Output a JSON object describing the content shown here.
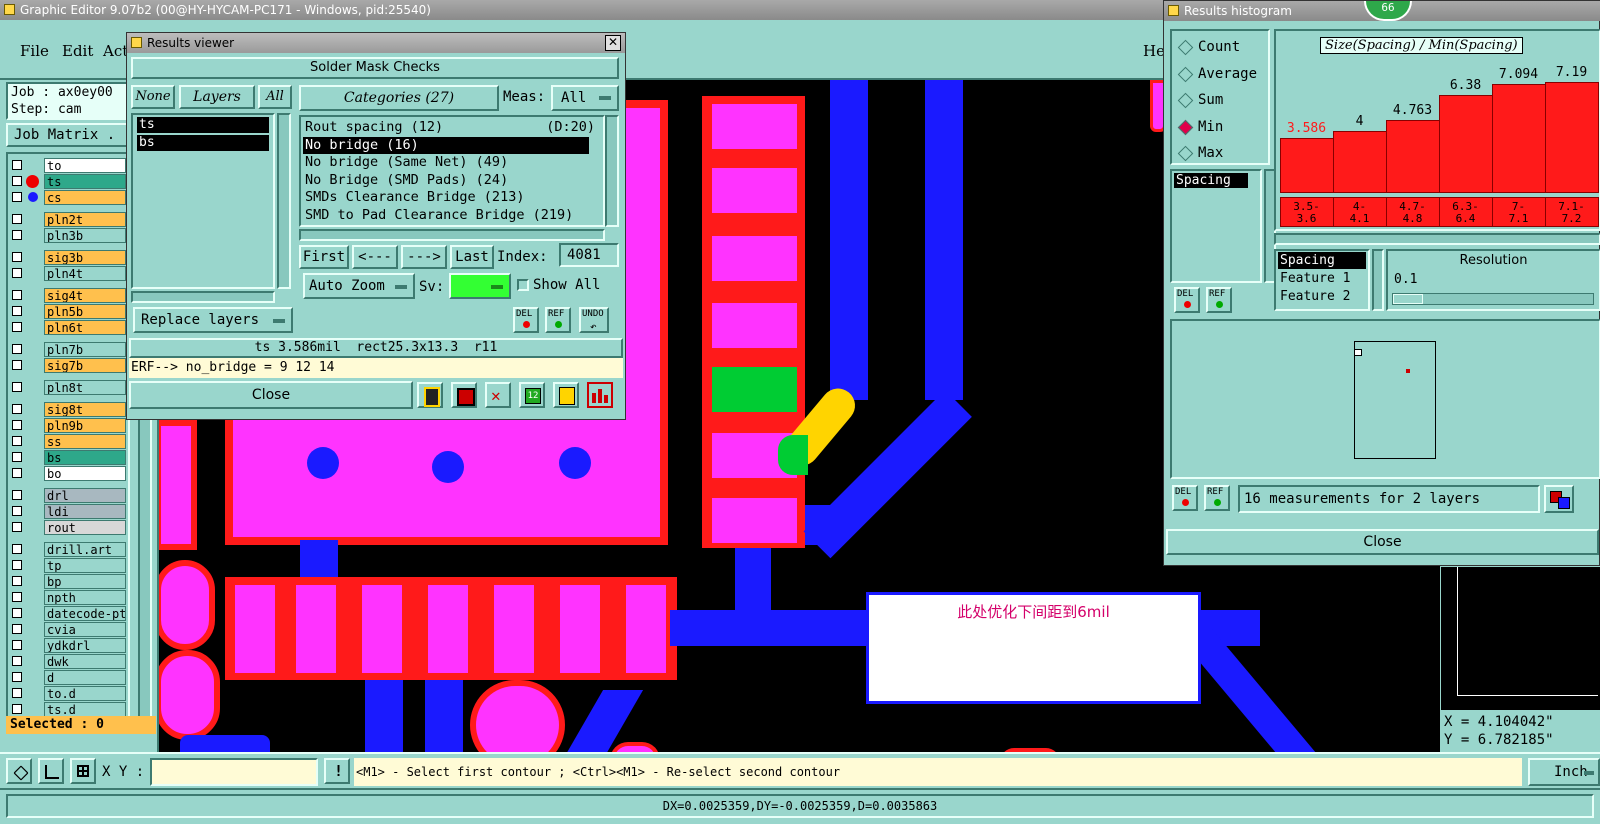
{
  "main_window": {
    "title": "Graphic Editor 9.07b2 (00@HY-HYCAM-PC171 - Windows, pid:25540)"
  },
  "menu": {
    "file": "File",
    "edit": "Edit",
    "actions": "Act",
    "help": "He"
  },
  "job": {
    "job_label": "Job : ax0ey00",
    "step_label": "Step: cam",
    "matrix_button": "Job Matrix ."
  },
  "layers": [
    {
      "name": "to",
      "color": "#ffffff"
    },
    {
      "name": "ts",
      "color": "#2ea88a"
    },
    {
      "name": "cs",
      "color": "#ffc04d"
    },
    {
      "name": "pln2t",
      "color": "#ffc04d"
    },
    {
      "name": "pln3b",
      "color": "#99d6cc"
    },
    {
      "name": "sig3b",
      "color": "#ffc04d"
    },
    {
      "name": "pln4t",
      "color": "#99d6cc"
    },
    {
      "name": "sig4t",
      "color": "#ffc04d"
    },
    {
      "name": "pln5b",
      "color": "#ffc04d"
    },
    {
      "name": "pln6t",
      "color": "#ffc04d"
    },
    {
      "name": "pln7b",
      "color": "#99d6cc"
    },
    {
      "name": "sig7b",
      "color": "#ffc04d"
    },
    {
      "name": "pln8t",
      "color": "#99d6cc"
    },
    {
      "name": "sig8t",
      "color": "#ffc04d"
    },
    {
      "name": "pln9b",
      "color": "#ffc04d"
    },
    {
      "name": "ss",
      "color": "#ffc04d"
    },
    {
      "name": "bs",
      "color": "#2ea88a"
    },
    {
      "name": "bo",
      "color": "#ffffff"
    },
    {
      "name": "drl",
      "color": "#a8b8c0"
    },
    {
      "name": "ldi",
      "color": "#a8b8c0"
    },
    {
      "name": "rout",
      "color": "#d8d8d8"
    },
    {
      "name": "drill.art",
      "color": "#99d6cc"
    },
    {
      "name": "tp",
      "color": "#99d6cc"
    },
    {
      "name": "bp",
      "color": "#99d6cc"
    },
    {
      "name": "npth",
      "color": "#99d6cc"
    },
    {
      "name": "datecode-pt",
      "color": "#99d6cc"
    },
    {
      "name": "cvia",
      "color": "#99d6cc"
    },
    {
      "name": "ydkdrl",
      "color": "#99d6cc"
    },
    {
      "name": "dwk",
      "color": "#99d6cc"
    },
    {
      "name": "d",
      "color": "#99d6cc"
    },
    {
      "name": "to.d",
      "color": "#99d6cc"
    },
    {
      "name": "ts.d",
      "color": "#99d6cc"
    }
  ],
  "selected_label": "Selected : 0",
  "results_viewer": {
    "title": "Results viewer",
    "header": "Solder Mask Checks",
    "btn_none": "None",
    "btn_layers": "Layers",
    "btn_all": "All",
    "layer_list": [
      "ts",
      "bs"
    ],
    "categories_button": "Categories (27)",
    "meas_label": "Meas:",
    "meas_value": "All",
    "categories": [
      {
        "label": "Rout spacing (12)",
        "extra": "(D:20)",
        "selected": false
      },
      {
        "label": "No bridge (16)",
        "extra": "",
        "selected": true
      },
      {
        "label": "No bridge (Same Net) (49)",
        "extra": "",
        "selected": false
      },
      {
        "label": "No Bridge (SMD Pads) (24)",
        "extra": "",
        "selected": false
      },
      {
        "label": "SMDs Clearance Bridge (213)",
        "extra": "",
        "selected": false
      },
      {
        "label": "SMD to Pad Clearance Bridge (219)",
        "extra": "",
        "selected": false
      }
    ],
    "nav": {
      "first": "First",
      "prev": "<---",
      "next": "--->",
      "last": "Last",
      "index_label": "Index:",
      "index_value": "4081"
    },
    "auto_zoom": "Auto Zoom",
    "sv_label": "Sv:",
    "show_all": "Show All",
    "replace_layers": "Replace layers",
    "del": "DEL",
    "ref": "REF",
    "undo": "UNDO",
    "info_line": "ts 3.586mil  rect25.3x13.3  r11",
    "erf_line": "ERF--> no_bridge = 9 12 14",
    "close": "Close"
  },
  "histogram": {
    "title": "Results histogram",
    "badge": "66",
    "modes": [
      {
        "label": "Count",
        "active": false
      },
      {
        "label": "Average",
        "active": false
      },
      {
        "label": "Sum",
        "active": false
      },
      {
        "label": "Min",
        "active": true
      },
      {
        "label": "Max",
        "active": false
      }
    ],
    "chart_title": "Size(Spacing) / Min(Spacing)",
    "spacing_list": [
      "Spacing"
    ],
    "options": [
      "Spacing",
      "Feature 1",
      "Feature 2"
    ],
    "resolution_label": "Resolution",
    "resolution_value": "0.1",
    "del": "DEL",
    "ref": "REF",
    "summary": "16 measurements for 2 layers",
    "close": "Close"
  },
  "chart_data": {
    "type": "bar",
    "title": "Size(Spacing) / Min(Spacing)",
    "categories": [
      "3.5-\n3.6",
      "4-\n4.1",
      "4.7-\n4.8",
      "6.3-\n6.4",
      "7-\n7.1",
      "7.1-\n7.2"
    ],
    "values": [
      3.586,
      4,
      4.763,
      6.38,
      7.094,
      7.19
    ],
    "value_labels": [
      "3.586",
      "4",
      "4.763",
      "6.38",
      "7.094",
      "7.19"
    ],
    "ylim": [
      0,
      7.4
    ],
    "first_label_color": "#ff1a1a"
  },
  "annotation": {
    "text": "此处优化下间距到6mil"
  },
  "coords": {
    "x": "X = 4.104042\"",
    "y": "Y = 6.782185\""
  },
  "bottom": {
    "xy_label": "X Y :",
    "xy_value": "",
    "hint": "<M1> - Select first contour ; <Ctrl><M1> - Re-select second contour",
    "unit": "Inch",
    "status": "DX=0.0025359,DY=-0.0025359,D=0.0035863"
  },
  "colors": {
    "panel": "#99d6cc",
    "pad": "#ff33ff",
    "mask": "#ff1a1a",
    "trace": "#1a1aff",
    "highlight": "#00cc33",
    "marker": "#ffd400"
  }
}
